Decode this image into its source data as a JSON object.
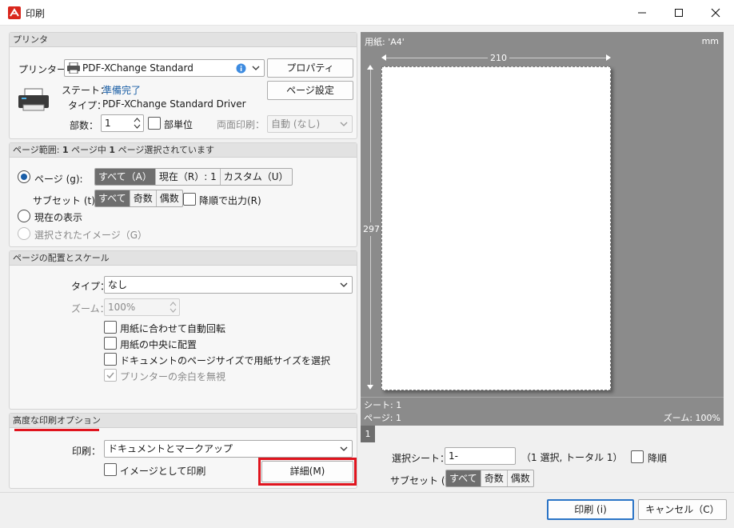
{
  "window": {
    "title": "印刷"
  },
  "printer_group": {
    "header": "プリンタ",
    "printer_label": "プリンター...",
    "printer_value": "PDF-XChange Standard",
    "properties_button": "プロパティ",
    "page_setup_button": "ページ設定",
    "state_label": "ステート：",
    "state_value": "準備完了",
    "type_label": "タイプ：",
    "type_value": "PDF-XChange Standard Driver",
    "copies_label": "部数：",
    "copies_value": "1",
    "collate_label": "部単位",
    "duplex_label": "両面印刷：",
    "duplex_value": "自動 (なし)"
  },
  "range_group": {
    "header_prefix": "ページ範囲: ",
    "header_n1": "1",
    "header_mid": " ページ中 ",
    "header_n2": "1",
    "header_suffix": " ページ選択されています",
    "pages_label": "ページ (g):",
    "pages_segments": [
      "すべて（A）",
      "現在（R）: 1",
      "カスタム（U）"
    ],
    "subset_label": "サブセット (t):",
    "subset_segments": [
      "すべて",
      "奇数",
      "偶数"
    ],
    "reverse_label": "降順で出力(R)",
    "current_view_label": "現在の表示",
    "selected_image_label": "選択されたイメージ（G）"
  },
  "layout_group": {
    "header": "ページの配置とスケール",
    "type_label": "タイプ：",
    "type_value": "なし",
    "zoom_label": "ズーム：",
    "zoom_value": "100%",
    "auto_rotate": "用紙に合わせて自動回転",
    "center_on_paper": "用紙の中央に配置",
    "choose_paper_by_pdf": "ドキュメントのページサイズで用紙サイズを選択",
    "ignore_margins": "プリンターの余白を無視"
  },
  "advanced_group": {
    "header": "高度な印刷オプション",
    "print_label": "印刷：",
    "print_value": "ドキュメントとマークアップ",
    "print_as_image": "イメージとして印刷",
    "details_button": "詳細(M)"
  },
  "preview": {
    "paper_label": "用紙: 'A4'",
    "unit": "mm",
    "width_value": "210",
    "height_value": "297",
    "sheet_info": "シート: 1",
    "page_info": "ページ: 1",
    "zoom_info": "ズーム: 100%",
    "page_number": "1"
  },
  "sheet_select": {
    "label": "選択シート：",
    "value": "1-",
    "info": "（1 選択, トータル 1）",
    "reverse_label": "降順",
    "subset_label": "サブセット (t):",
    "subset_segments": [
      "すべて",
      "奇数",
      "偶数"
    ]
  },
  "footer": {
    "print_button": "印刷 (i)",
    "cancel_button": "キャンセル（C）"
  },
  "colors": {
    "highlight_red": "#e0141e",
    "accent_blue": "#1b5fa6",
    "preview_bg": "#8b8b8b"
  }
}
